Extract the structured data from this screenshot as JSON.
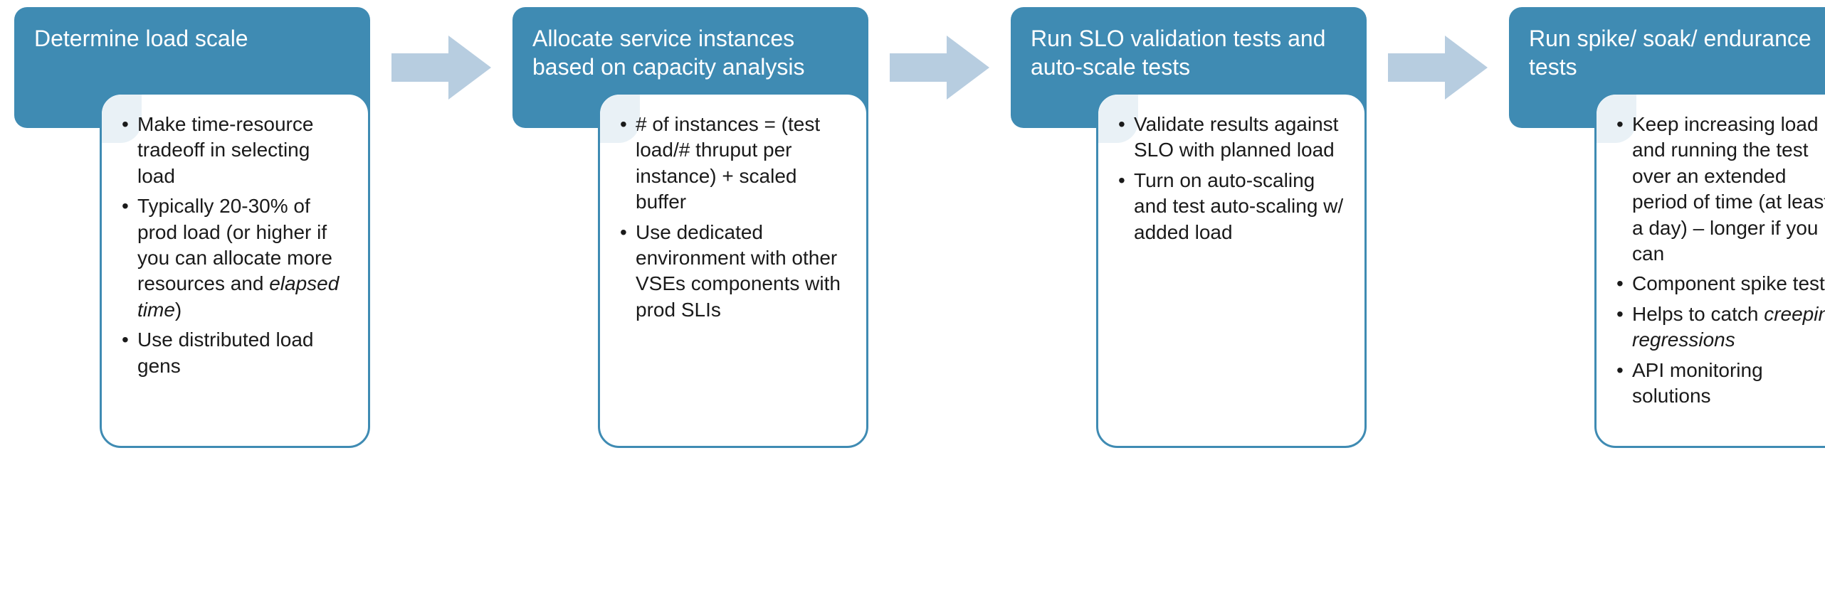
{
  "colors": {
    "header_bg": "#3f8bb3",
    "border": "#3f8bb3",
    "arrow": "#b7cde0",
    "corner": "#e9f1f6"
  },
  "steps": [
    {
      "title": "Determine load scale",
      "bullets": [
        "Make time-resource tradeoff in selecting load",
        "Typically 20-30% of prod load (or higher if you can allocate more resources and <em>elapsed time</em>)",
        "Use distributed load gens"
      ]
    },
    {
      "title": "Allocate service instances based on capacity analysis",
      "bullets": [
        "# of instances = (test load/# thruput per instance) + scaled buffer",
        "Use dedicated environment with other VSEs components with prod SLIs"
      ]
    },
    {
      "title": "Run SLO validation tests and auto-scale tests",
      "bullets": [
        "Validate results against SLO with planned load",
        "Turn on auto-scaling and test auto-scaling w/ added load"
      ]
    },
    {
      "title": "Run spike/ soak/ endurance tests",
      "bullets": [
        "Keep increasing load and running the test over an extended period of time (at least a day) – longer if you can",
        "Component spike tests",
        "Helps to catch <em>creeping regressions</em>",
        "API monitoring solutions"
      ]
    }
  ]
}
